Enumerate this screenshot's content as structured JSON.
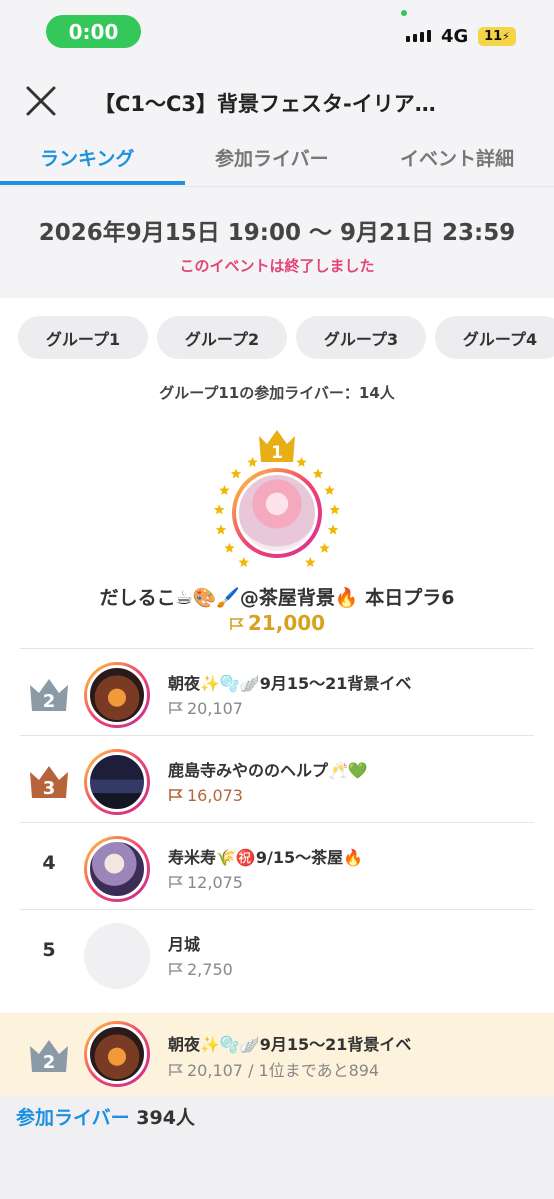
{
  "status_bar": {
    "time": "0:00",
    "network": "4G",
    "battery": "11"
  },
  "header": {
    "title": "【C1〜C3】背景フェスタ-イリア…"
  },
  "tabs": [
    {
      "label": "ランキング",
      "active": true
    },
    {
      "label": "参加ライバー",
      "active": false
    },
    {
      "label": "イベント詳細",
      "active": false
    }
  ],
  "event": {
    "period": "2026年9月15日 19:00 〜 9月21日 23:59",
    "status": "このイベントは終了しました"
  },
  "groups": [
    "グループ1",
    "グループ2",
    "グループ3",
    "グループ4"
  ],
  "group_summary": "グループ11の参加ライバー：14人",
  "first_place": {
    "rank": "1",
    "name": "だしるこ☕🎨🖌️@茶屋背景🔥 本日プラ6",
    "points": "21,000"
  },
  "ranking": [
    {
      "rank": "2",
      "name": "朝夜✨🫧🪽9月15〜21背景イベ",
      "points": "20,107",
      "badge": "silver"
    },
    {
      "rank": "3",
      "name": "鹿島寺みやののヘルプ🥂💚",
      "points": "16,073",
      "badge": "bronze"
    },
    {
      "rank": "4",
      "name": "寿米寿🌾㊗️9/15〜茶屋🔥",
      "points": "12,075",
      "badge": "none"
    },
    {
      "rank": "5",
      "name": "月城",
      "points": "2,750",
      "badge": "none"
    }
  ],
  "my_rank": {
    "rank": "2",
    "name": "朝夜✨🫧🪽9月15〜21背景イベ",
    "points_text": "20,107 / 1位まであと894"
  },
  "footer": {
    "link_label": "参加ライバー",
    "count": "394人"
  },
  "colors": {
    "accent": "#1e90e0",
    "gold": "#d7a21f",
    "silver": "#8a9aa6",
    "bronze": "#b8643a",
    "ended": "#e2457a"
  }
}
